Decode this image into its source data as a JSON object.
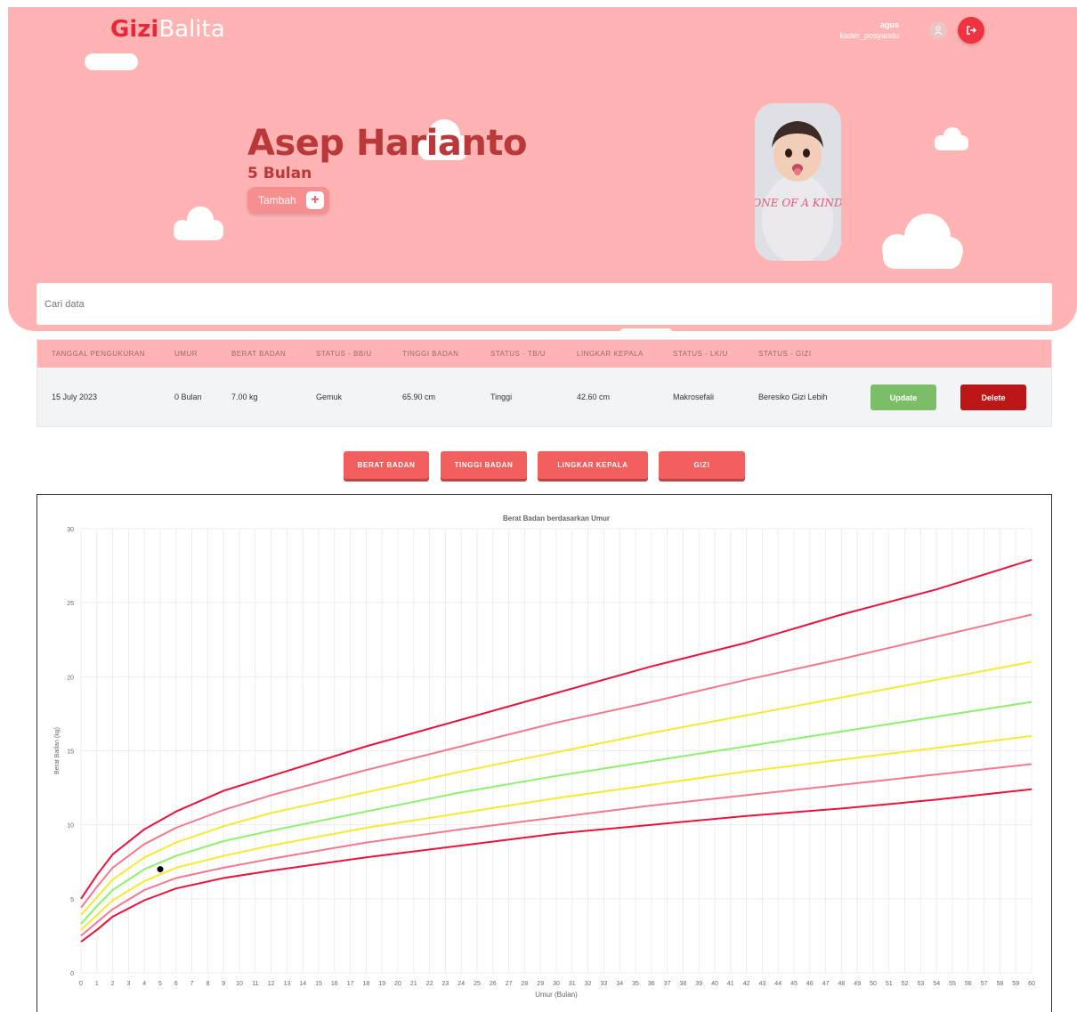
{
  "brand": {
    "part1": "Gizi",
    "part2": "Balita"
  },
  "user": {
    "name": "agus",
    "role": "kader_posyandu"
  },
  "child": {
    "name": "Asep Harianto",
    "age": "5 Bulan",
    "add_label": "Tambah"
  },
  "photo": {
    "text": "ONE OF A KIND"
  },
  "search": {
    "placeholder": "Cari data"
  },
  "table": {
    "headers": [
      "TANGGAL PENGUKURAN",
      "UMUR",
      "BERAT BADAN",
      "STATUS - BB/U",
      "TINGGI BADAN",
      "STATUS - TB/U",
      "LINGKAR KEPALA",
      "STATUS - LK/U",
      "STATUS - GIZI"
    ],
    "rows": [
      {
        "cells": [
          "15 July 2023",
          "0 Bulan",
          "7.00 kg",
          "Gemuk",
          "65.90 cm",
          "Tinggi",
          "42.60 cm",
          "Makrosefali",
          "Beresiko Gizi Lebih"
        ]
      }
    ],
    "update_label": "Update",
    "delete_label": "Delete"
  },
  "tabs": [
    "BERAT BADAN",
    "TINGGI BADAN",
    "LINGKAR KEPALA",
    "GIZI"
  ],
  "colors": {
    "hero": "#ffb3b3",
    "accent": "#ef3340",
    "name": "#b9383a"
  },
  "chart_data": {
    "type": "line",
    "title": "Berat Badan berdasarkan Umur",
    "xlabel": "Umur (Bulan)",
    "ylabel": "Berat Badan (kg)",
    "xlim": [
      0,
      60
    ],
    "ylim": [
      0,
      30
    ],
    "yticks": [
      0,
      5,
      10,
      15,
      20,
      25,
      30
    ],
    "grid": true,
    "series": [
      {
        "color": "#e8143c",
        "points": [
          [
            0,
            2.1
          ],
          [
            1,
            2.9
          ],
          [
            2,
            3.8
          ],
          [
            4,
            4.9
          ],
          [
            6,
            5.7
          ],
          [
            9,
            6.4
          ],
          [
            12,
            6.9
          ],
          [
            18,
            7.8
          ],
          [
            24,
            8.6
          ],
          [
            30,
            9.4
          ],
          [
            36,
            10.0
          ],
          [
            42,
            10.6
          ],
          [
            48,
            11.1
          ],
          [
            54,
            11.7
          ],
          [
            60,
            12.4
          ]
        ]
      },
      {
        "color": "#f27a8c",
        "points": [
          [
            0,
            2.5
          ],
          [
            1,
            3.4
          ],
          [
            2,
            4.3
          ],
          [
            4,
            5.6
          ],
          [
            6,
            6.4
          ],
          [
            9,
            7.1
          ],
          [
            12,
            7.7
          ],
          [
            18,
            8.8
          ],
          [
            24,
            9.7
          ],
          [
            30,
            10.5
          ],
          [
            36,
            11.3
          ],
          [
            42,
            12.0
          ],
          [
            48,
            12.7
          ],
          [
            54,
            13.4
          ],
          [
            60,
            14.1
          ]
        ]
      },
      {
        "color": "#f4ea32",
        "points": [
          [
            0,
            2.9
          ],
          [
            1,
            3.9
          ],
          [
            2,
            4.9
          ],
          [
            4,
            6.2
          ],
          [
            6,
            7.1
          ],
          [
            9,
            7.9
          ],
          [
            12,
            8.6
          ],
          [
            18,
            9.8
          ],
          [
            24,
            10.8
          ],
          [
            30,
            11.8
          ],
          [
            36,
            12.7
          ],
          [
            42,
            13.6
          ],
          [
            48,
            14.4
          ],
          [
            54,
            15.2
          ],
          [
            60,
            16.0
          ]
        ]
      },
      {
        "color": "#8df06e",
        "points": [
          [
            0,
            3.3
          ],
          [
            1,
            4.5
          ],
          [
            2,
            5.6
          ],
          [
            4,
            7.0
          ],
          [
            6,
            7.9
          ],
          [
            9,
            8.9
          ],
          [
            12,
            9.6
          ],
          [
            18,
            10.9
          ],
          [
            24,
            12.2
          ],
          [
            30,
            13.3
          ],
          [
            36,
            14.3
          ],
          [
            42,
            15.3
          ],
          [
            48,
            16.3
          ],
          [
            54,
            17.3
          ],
          [
            60,
            18.3
          ]
        ]
      },
      {
        "color": "#f4ea32",
        "points": [
          [
            0,
            3.9
          ],
          [
            1,
            5.1
          ],
          [
            2,
            6.3
          ],
          [
            4,
            7.8
          ],
          [
            6,
            8.8
          ],
          [
            9,
            9.9
          ],
          [
            12,
            10.8
          ],
          [
            18,
            12.2
          ],
          [
            24,
            13.6
          ],
          [
            30,
            14.9
          ],
          [
            36,
            16.2
          ],
          [
            42,
            17.4
          ],
          [
            48,
            18.6
          ],
          [
            54,
            19.8
          ],
          [
            60,
            21.0
          ]
        ]
      },
      {
        "color": "#f27a8c",
        "points": [
          [
            0,
            4.4
          ],
          [
            1,
            5.8
          ],
          [
            2,
            7.1
          ],
          [
            4,
            8.7
          ],
          [
            6,
            9.8
          ],
          [
            9,
            11.0
          ],
          [
            12,
            12.0
          ],
          [
            18,
            13.7
          ],
          [
            24,
            15.3
          ],
          [
            30,
            16.9
          ],
          [
            36,
            18.3
          ],
          [
            42,
            19.8
          ],
          [
            48,
            21.2
          ],
          [
            54,
            22.7
          ],
          [
            60,
            24.2
          ]
        ]
      },
      {
        "color": "#e8143c",
        "points": [
          [
            0,
            5.0
          ],
          [
            1,
            6.6
          ],
          [
            2,
            8.0
          ],
          [
            4,
            9.7
          ],
          [
            6,
            10.9
          ],
          [
            9,
            12.3
          ],
          [
            12,
            13.3
          ],
          [
            18,
            15.3
          ],
          [
            24,
            17.1
          ],
          [
            30,
            18.9
          ],
          [
            36,
            20.7
          ],
          [
            42,
            22.3
          ],
          [
            48,
            24.2
          ],
          [
            54,
            25.9
          ],
          [
            60,
            27.9
          ]
        ]
      }
    ],
    "points": [
      {
        "x": 5,
        "y": 7.0,
        "color": "#000000"
      }
    ]
  }
}
